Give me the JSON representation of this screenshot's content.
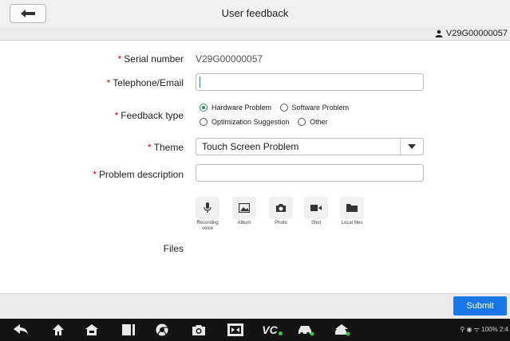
{
  "header": {
    "title": "User feedback"
  },
  "user": {
    "serial": "V29G00000057"
  },
  "form": {
    "serial_label": "Serial number",
    "serial_value": "V29G00000057",
    "contact_label": "Telephone/Email",
    "contact_value": "",
    "feedback_type_label": "Feedback type",
    "feedback_options": [
      "Hardware Problem",
      "Software Problem",
      "Optimization Suggestion",
      "Other"
    ],
    "feedback_selected": "Hardware Problem",
    "theme_label": "Theme",
    "theme_value": "Touch Screen Problem",
    "description_label": "Problem description",
    "description_value": "",
    "files_label": "Files"
  },
  "attachments": [
    {
      "label": "Recording voice",
      "icon": "microphone-icon"
    },
    {
      "label": "Album",
      "icon": "image-icon"
    },
    {
      "label": "Photo",
      "icon": "camera-icon"
    },
    {
      "label": "Shot",
      "icon": "video-icon"
    },
    {
      "label": "Local files",
      "icon": "folder-icon"
    }
  ],
  "footer": {
    "submit_label": "Submit"
  },
  "navbar": {
    "icons": [
      "back-icon",
      "home-icon",
      "house-icon",
      "recent-apps-icon",
      "chrome-icon",
      "camera-icon",
      "screen-capture-icon",
      "vci-icon",
      "car-icon",
      "car-home-icon"
    ],
    "vci_text": "VC",
    "status": "100% 2:4"
  },
  "colors": {
    "accent": "#1877e6",
    "required": "#d0021b",
    "radio": "#2e8b57",
    "vci_green": "#37c34b"
  }
}
